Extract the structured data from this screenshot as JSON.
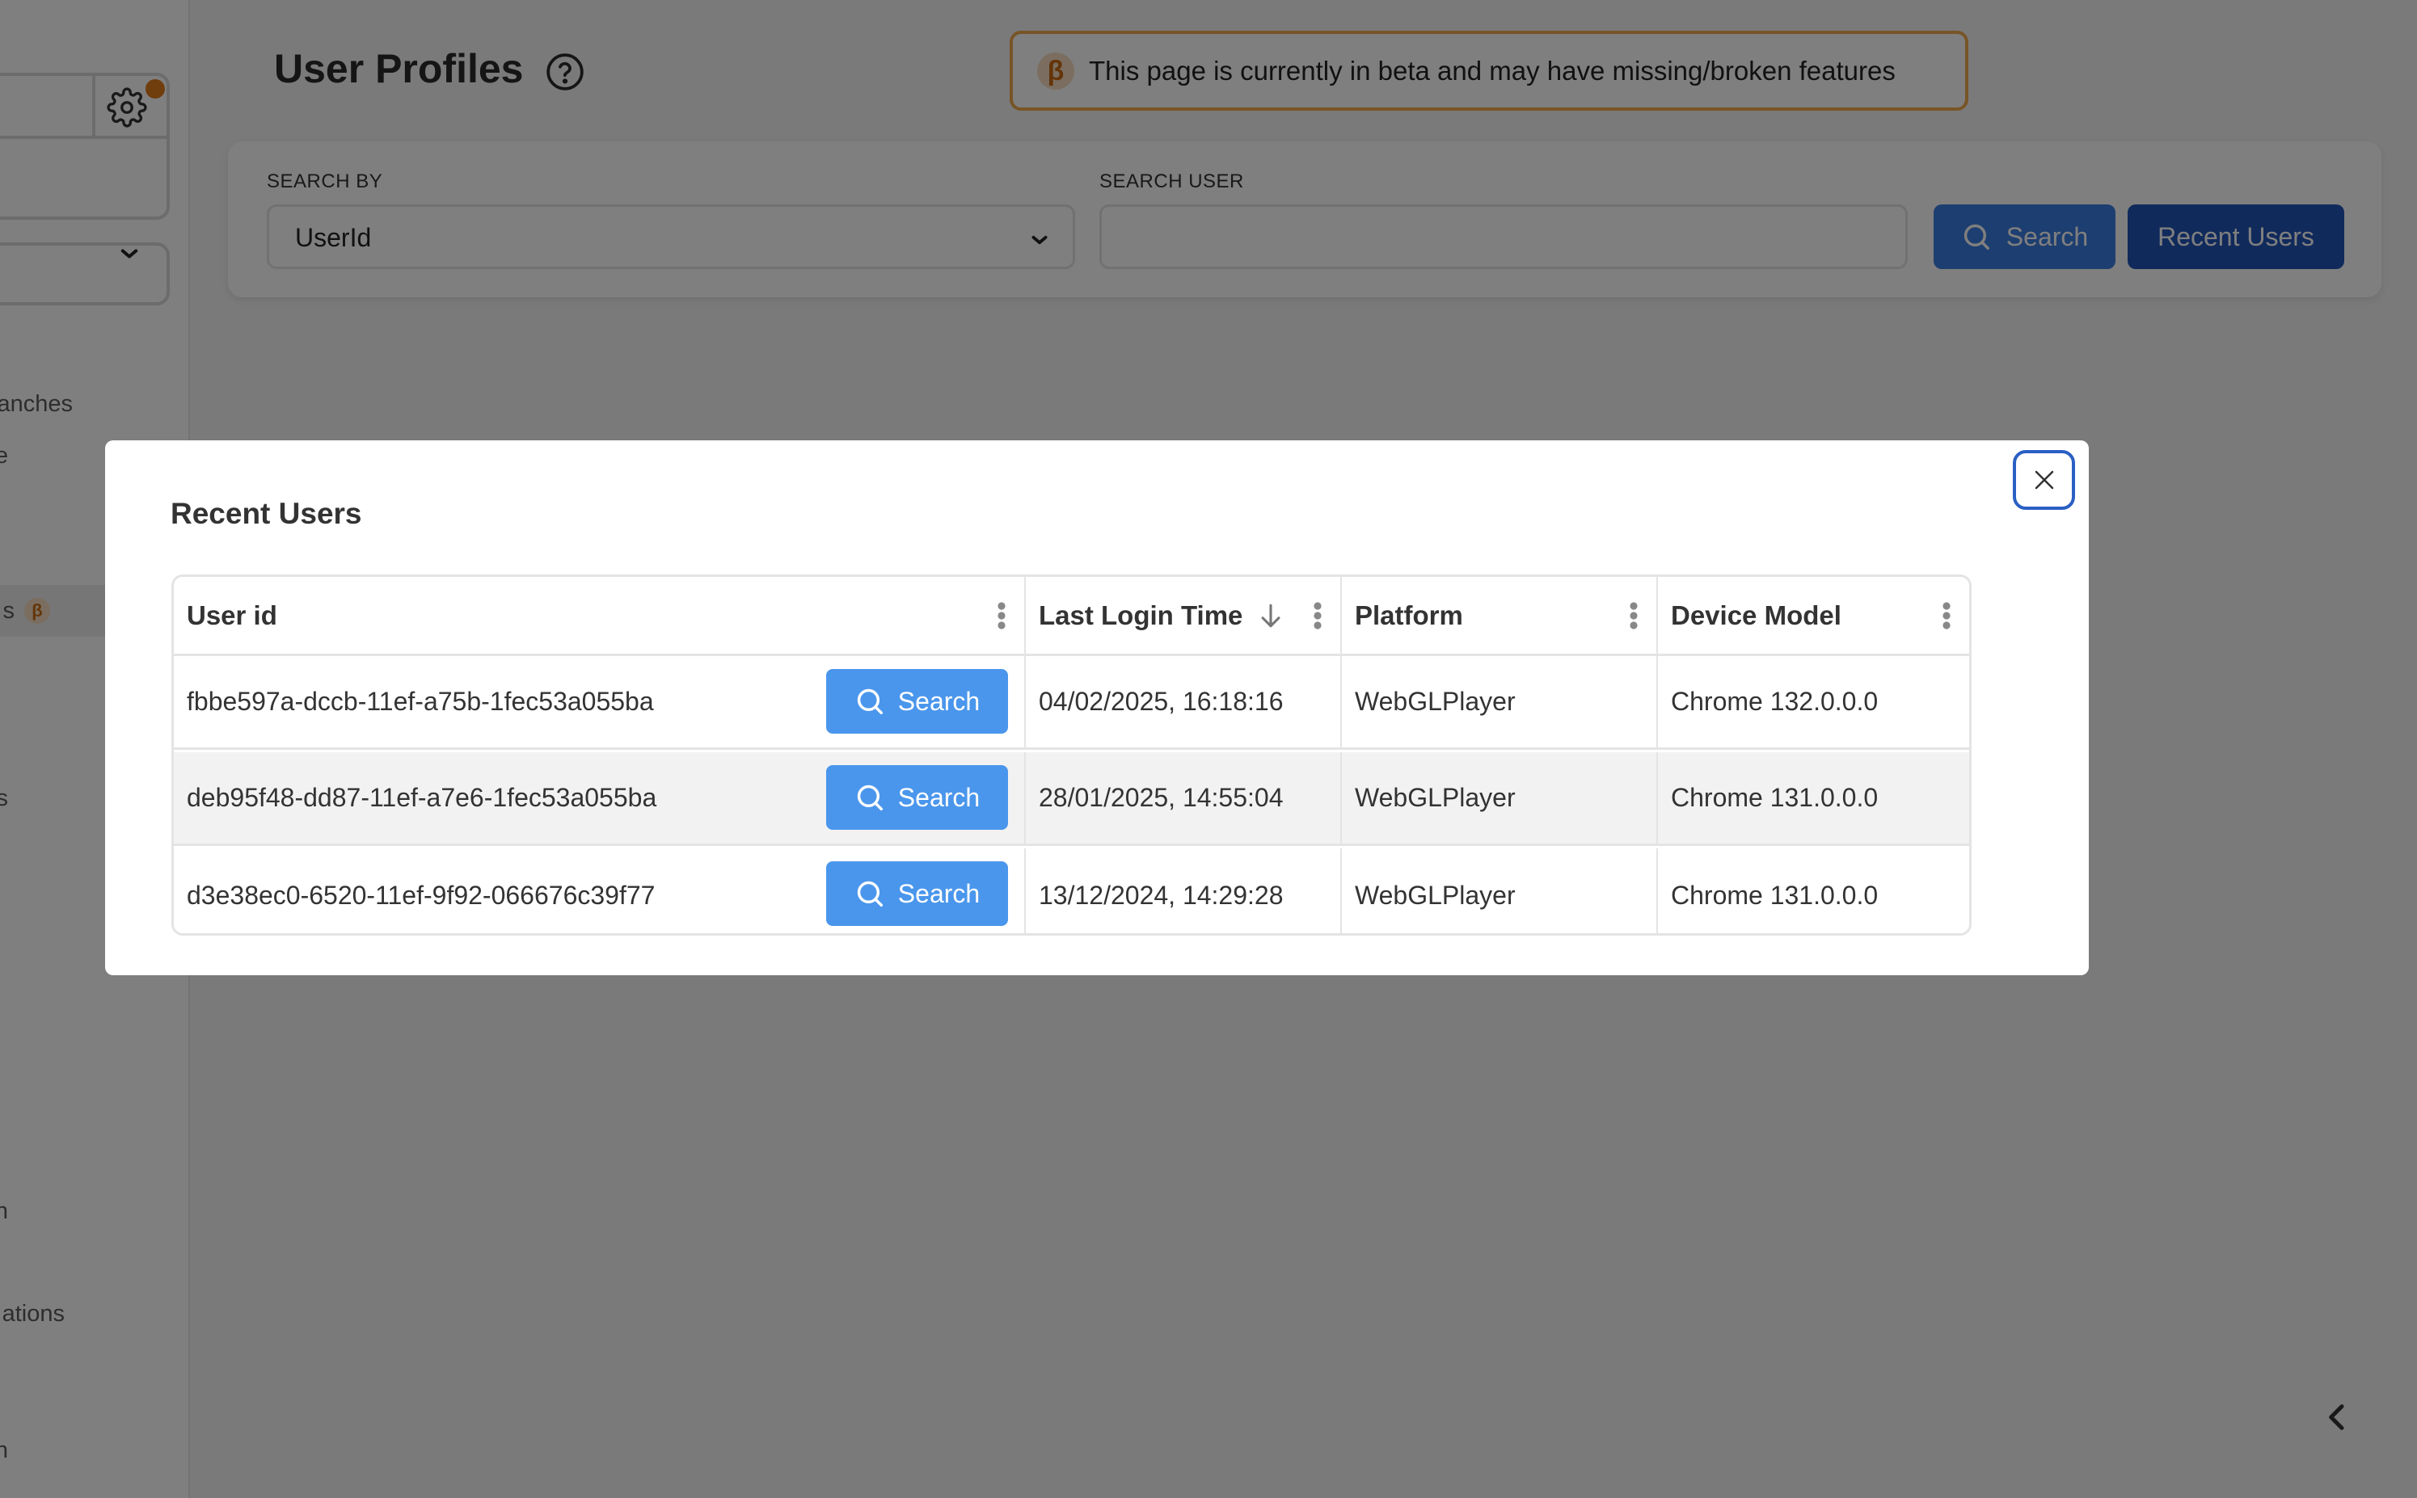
{
  "sidebar": {
    "items": [
      {
        "label": "anches",
        "selected": false
      },
      {
        "label": "ure",
        "selected": false
      },
      {
        "label": "s",
        "selected": true,
        "badge": "β"
      },
      {
        "label": "s",
        "selected": false
      },
      {
        "label": "on",
        "selected": false
      },
      {
        "label": "ations",
        "selected": false
      },
      {
        "label": "eton",
        "selected": false
      }
    ],
    "notification_color": "#e07b1a"
  },
  "header": {
    "title": "User Profiles",
    "help_icon": "question-circle-icon"
  },
  "beta_banner": {
    "badge": "β",
    "text": "This page is currently in beta and may have missing/broken features",
    "accent_color": "#f0a94d"
  },
  "search_panel": {
    "search_by_label": "SEARCH BY",
    "search_by_value": "UserId",
    "search_user_label": "SEARCH USER",
    "search_user_value": "",
    "search_button": "Search",
    "recent_users_button": "Recent Users"
  },
  "modal": {
    "title": "Recent Users",
    "close_icon": "close-icon",
    "table": {
      "columns": [
        {
          "label": "User id"
        },
        {
          "label": "Last Login Time",
          "sort": "descending"
        },
        {
          "label": "Platform"
        },
        {
          "label": "Device Model"
        }
      ],
      "rows": [
        {
          "user_id": "fbbe597a-dccb-11ef-a75b-1fec53a055ba",
          "action": "Search",
          "last_login": "04/02/2025, 16:18:16",
          "platform": "WebGLPlayer",
          "device_model": "Chrome 132.0.0.0"
        },
        {
          "user_id": "deb95f48-dd87-11ef-a7e6-1fec53a055ba",
          "action": "Search",
          "last_login": "28/01/2025, 14:55:04",
          "platform": "WebGLPlayer",
          "device_model": "Chrome 131.0.0.0"
        },
        {
          "user_id": "d3e38ec0-6520-11ef-9f92-066676c39f77",
          "action": "Search",
          "last_login": "13/12/2024, 14:29:28",
          "platform": "WebGLPlayer",
          "device_model": "Chrome 131.0.0.0"
        }
      ]
    }
  },
  "colors": {
    "primary_button": "#3b7de0",
    "secondary_button": "#2255b8",
    "row_button": "#4a96ec",
    "close_border": "#2a5fc4"
  }
}
